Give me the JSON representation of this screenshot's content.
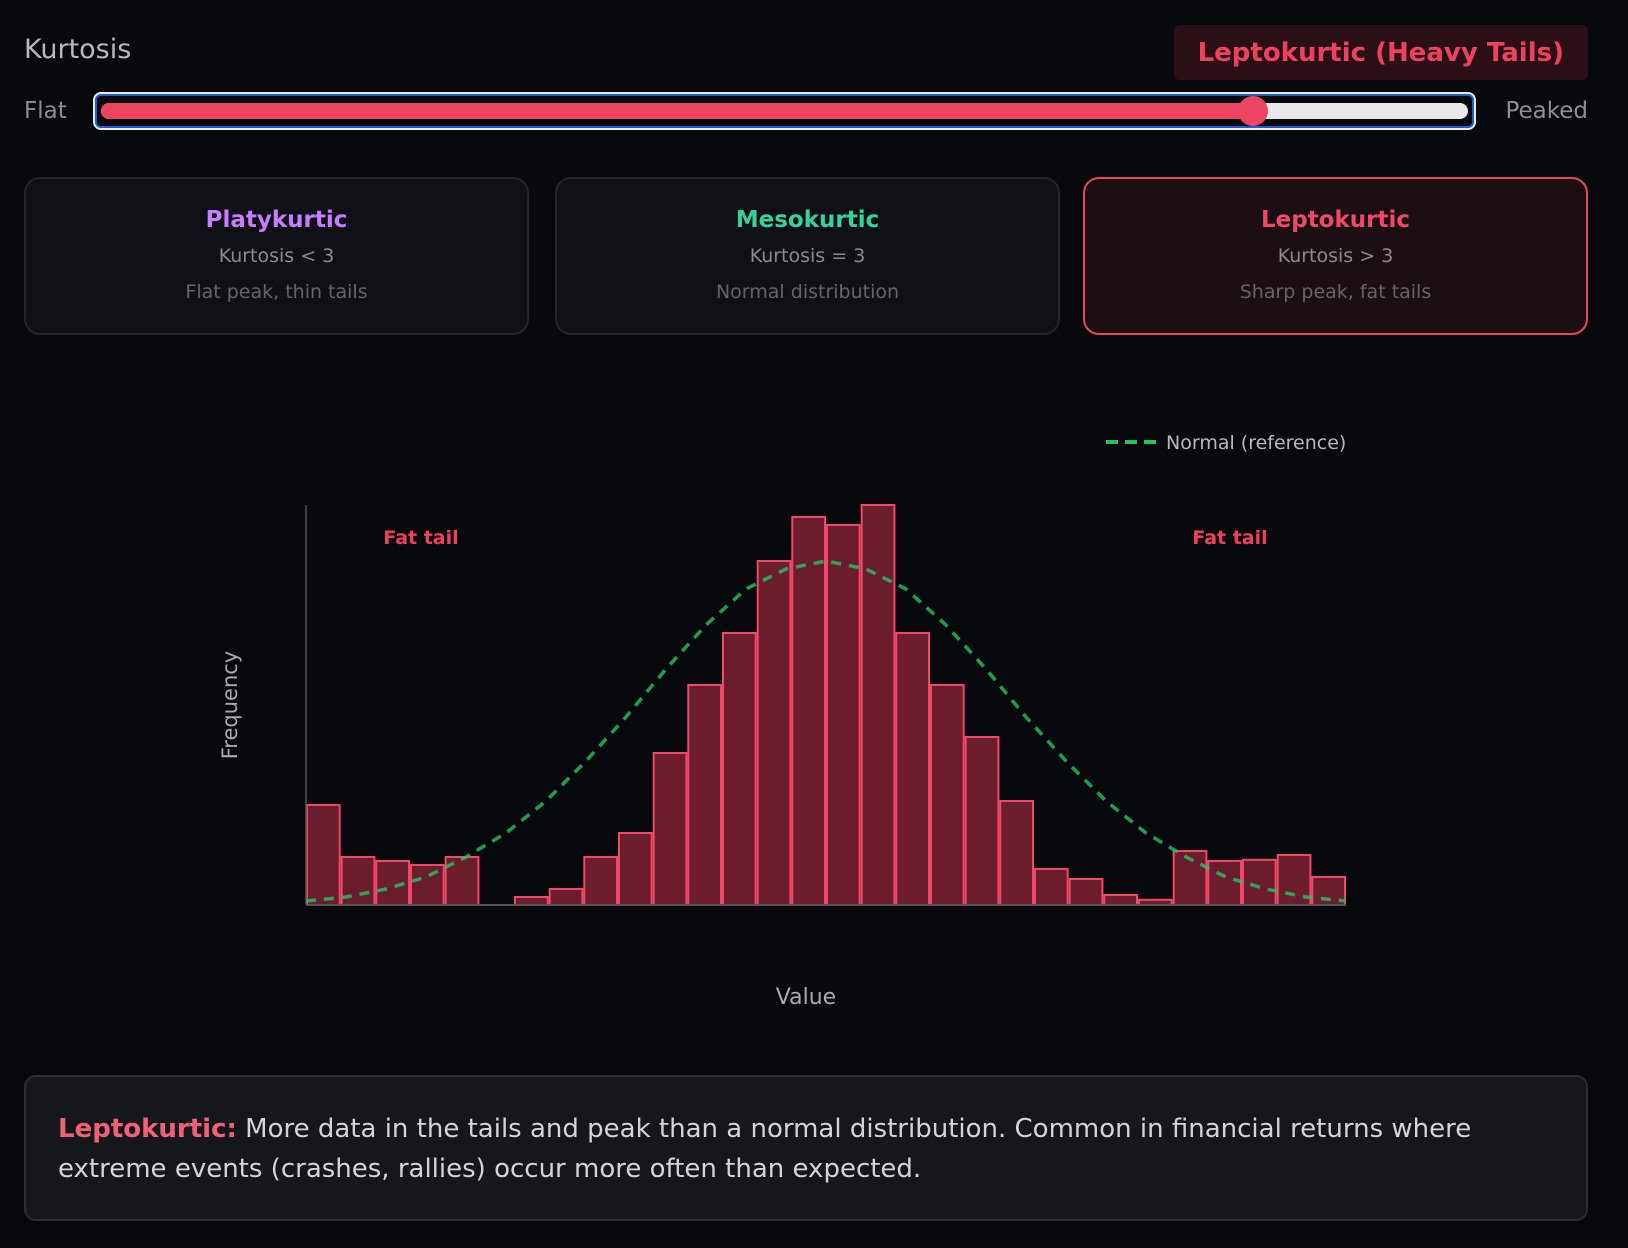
{
  "header": {
    "label": "Kurtosis",
    "badge": "Leptokurtic (Heavy Tails)",
    "badge_color": "#f0405f"
  },
  "slider": {
    "min_label": "Flat",
    "max_label": "Peaked",
    "value_fraction": 0.84,
    "fill_color": "#ee4562"
  },
  "cards": [
    {
      "title": "Platykurtic",
      "rule": "Kurtosis < 3",
      "desc": "Flat peak, thin tails",
      "color": "#c77dff",
      "active": false
    },
    {
      "title": "Mesokurtic",
      "rule": "Kurtosis = 3",
      "desc": "Normal distribution",
      "color": "#34d399",
      "active": false
    },
    {
      "title": "Leptokurtic",
      "rule": "Kurtosis > 3",
      "desc": "Sharp peak, fat tails",
      "color": "#f0476a",
      "active": true
    }
  ],
  "chart_data": {
    "type": "bar",
    "xlabel": "Value",
    "ylabel": "Frequency",
    "legend": [
      {
        "name": "Normal (reference)",
        "style": "dashed",
        "color": "#22c55e"
      }
    ],
    "legend_position": "top-right",
    "annotations": [
      "Fat tail",
      "Fat tail"
    ],
    "annotation_color": "#f0405f",
    "bar_fill": "#6b1d2e",
    "bar_stroke": "#f0476a",
    "values": [
      0.25,
      0.12,
      0.11,
      0.1,
      0.12,
      0,
      0.02,
      0.04,
      0.12,
      0.18,
      0.38,
      0.55,
      0.68,
      0.86,
      0.97,
      0.95,
      1.0,
      0.68,
      0.55,
      0.42,
      0.26,
      0.09,
      0.065,
      0.025,
      0.013,
      0.135,
      0.11,
      0.113,
      0.125,
      0.07
    ],
    "normal_curve": [
      0.01,
      0.02,
      0.04,
      0.07,
      0.12,
      0.18,
      0.26,
      0.36,
      0.47,
      0.59,
      0.7,
      0.79,
      0.84,
      0.86,
      0.84,
      0.79,
      0.7,
      0.59,
      0.47,
      0.36,
      0.26,
      0.18,
      0.12,
      0.07,
      0.04,
      0.02,
      0.01
    ],
    "ylim": [
      0,
      1
    ],
    "grid": false
  },
  "explanation": {
    "lead": "Leptokurtic:",
    "text": " More data in the tails and peak than a normal distribution. Common in financial returns where extreme events (crashes, rallies) occur more often than expected."
  }
}
